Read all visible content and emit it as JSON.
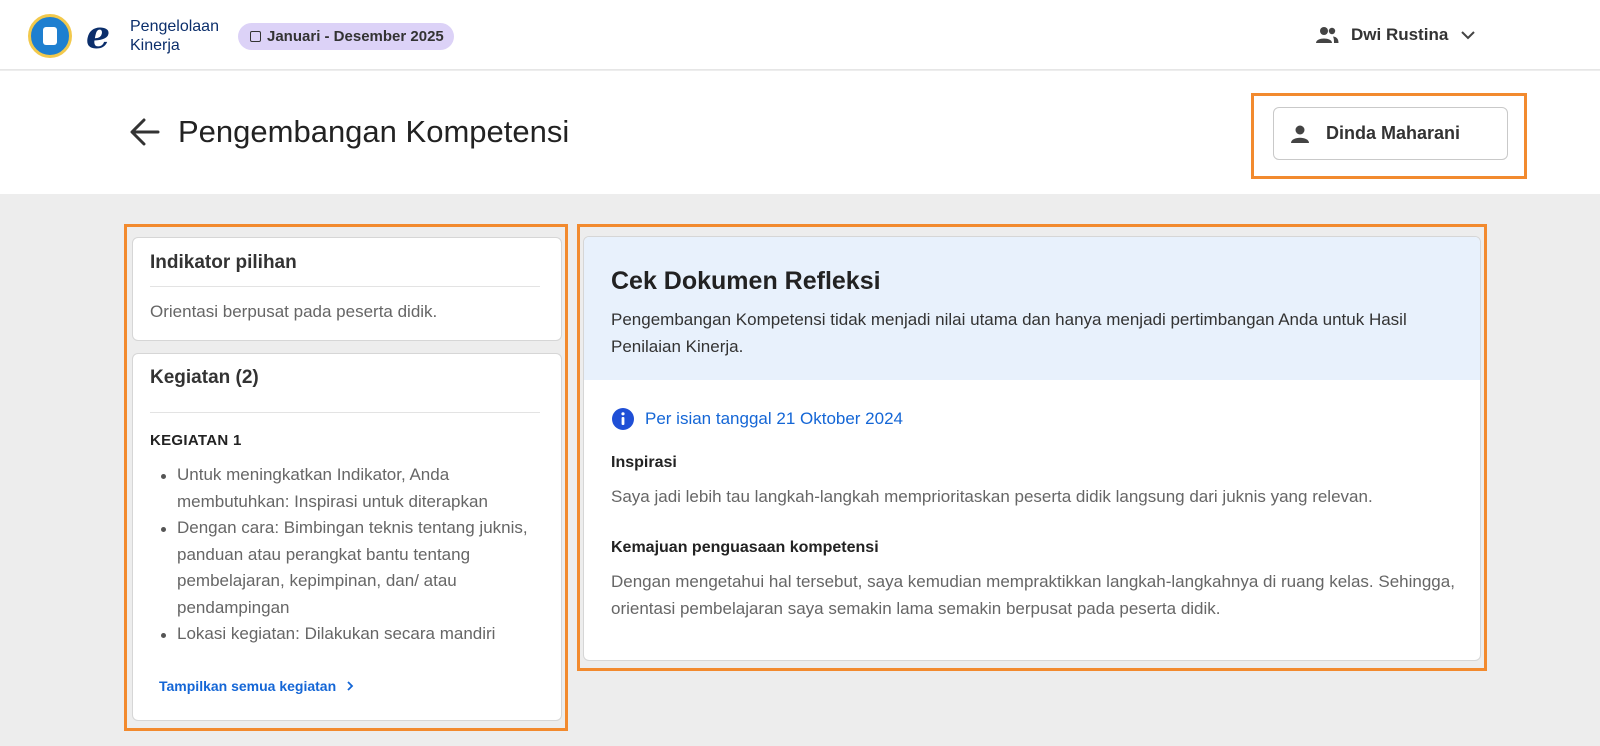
{
  "topbar": {
    "brand_mark": "e",
    "brand_line1": "Pengelolaan",
    "brand_line2": "Kinerja",
    "period": "Januari - Desember 2025",
    "user_name": "Dwi Rustina"
  },
  "header": {
    "title": "Pengembangan Kompetensi",
    "teacher_name": "Dinda Maharani"
  },
  "indikator": {
    "title": "Indikator pilihan",
    "value": "Orientasi berpusat pada peserta didik."
  },
  "kegiatan": {
    "title": "Kegiatan (2)",
    "item_label": "KEGIATAN 1",
    "bullets": [
      "Untuk meningkatkan Indikator, Anda membutuhkan: Inspirasi untuk diterapkan",
      "Dengan cara: Bimbingan teknis tentang juknis, panduan atau perangkat bantu tentang pembelajaran, kepimpinan, dan/ atau pendampingan",
      "Lokasi kegiatan: Dilakukan secara mandiri"
    ],
    "show_all": "Tampilkan semua kegiatan"
  },
  "refleksi": {
    "title": "Cek Dokumen Refleksi",
    "description": "Pengembangan Kompetensi tidak menjadi nilai utama dan hanya menjadi pertimbangan Anda untuk Hasil Penilaian Kinerja.",
    "date_info": "Per isian tanggal 21 Oktober 2024",
    "inspirasi_label": "Inspirasi",
    "inspirasi_text": "Saya jadi lebih tau langkah-langkah memprioritaskan peserta didik langsung dari juknis yang relevan.",
    "kemajuan_label": "Kemajuan penguasaan kompetensi",
    "kemajuan_text": "Dengan mengetahui hal tersebut, saya kemudian mempraktikkan langkah-langkahnya di ruang kelas. Sehingga, orientasi pembelajaran saya semakin lama semakin berpusat pada peserta didik."
  },
  "colors": {
    "highlight": "#f28a2e",
    "link": "#1466d6",
    "period_badge": "#dcd2f7",
    "refleksi_header": "#e8f1fc"
  }
}
